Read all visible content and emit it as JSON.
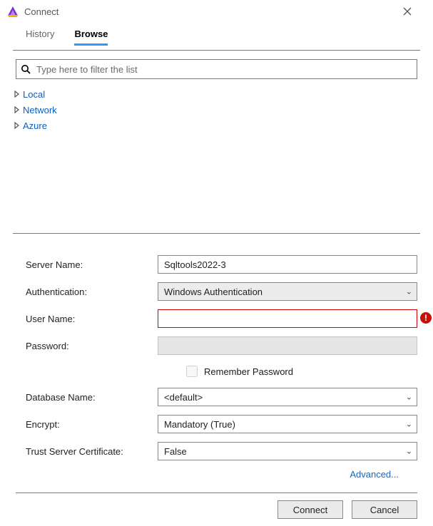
{
  "titlebar": {
    "title": "Connect"
  },
  "tabs": {
    "history": "History",
    "browse": "Browse",
    "active": "browse"
  },
  "search": {
    "placeholder": "Type here to filter the list"
  },
  "tree": [
    {
      "label": "Local"
    },
    {
      "label": "Network"
    },
    {
      "label": "Azure"
    }
  ],
  "form": {
    "server_name_label": "Server Name:",
    "server_name_value": "Sqltools2022-3",
    "authentication_label": "Authentication:",
    "authentication_value": "Windows Authentication",
    "user_name_label": "User Name:",
    "user_name_value": "",
    "password_label": "Password:",
    "password_value": "",
    "remember_password_label": "Remember Password",
    "remember_password_checked": false,
    "database_name_label": "Database Name:",
    "database_name_value": "<default>",
    "encrypt_label": "Encrypt:",
    "encrypt_value": "Mandatory (True)",
    "trust_cert_label": "Trust Server Certificate:",
    "trust_cert_value": "False",
    "advanced_link": "Advanced..."
  },
  "footer": {
    "connect": "Connect",
    "cancel": "Cancel"
  }
}
